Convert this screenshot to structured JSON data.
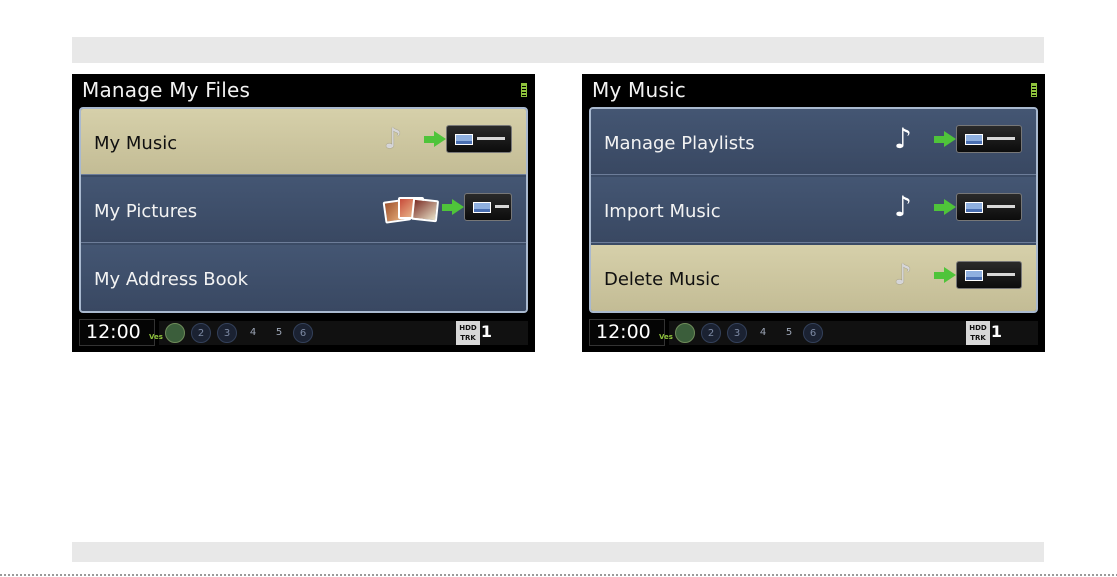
{
  "screens": [
    {
      "title": "Manage My Files",
      "items": [
        {
          "label": "My Music",
          "selected": true,
          "icon": "music-note-to-hdd-icon"
        },
        {
          "label": "My Pictures",
          "selected": false,
          "icon": "pictures-to-hdd-icon"
        },
        {
          "label": "My Address Book",
          "selected": false,
          "icon": ""
        }
      ],
      "clock": "12:00",
      "status": {
        "v_tag": "Ves",
        "presets": [
          "2",
          "3",
          "4",
          "5",
          "6"
        ],
        "hdd_label": "HDD",
        "trk_label": "TRK",
        "track": "1"
      }
    },
    {
      "title": "My Music",
      "items": [
        {
          "label": "Manage Playlists",
          "selected": false,
          "icon": "music-note-to-hdd-icon"
        },
        {
          "label": "Import Music",
          "selected": false,
          "icon": "music-note-to-hdd-icon"
        },
        {
          "label": "Delete Music",
          "selected": true,
          "icon": "music-note-to-hdd-icon"
        }
      ],
      "clock": "12:00",
      "status": {
        "v_tag": "Ves",
        "presets": [
          "2",
          "3",
          "4",
          "5",
          "6"
        ],
        "hdd_label": "HDD",
        "trk_label": "TRK",
        "track": "1"
      }
    }
  ],
  "colors": {
    "selected_row": "#cfc9a3",
    "row": "#3f506c",
    "list_border": "#a9b9cf",
    "arrow": "#4fc43a"
  }
}
